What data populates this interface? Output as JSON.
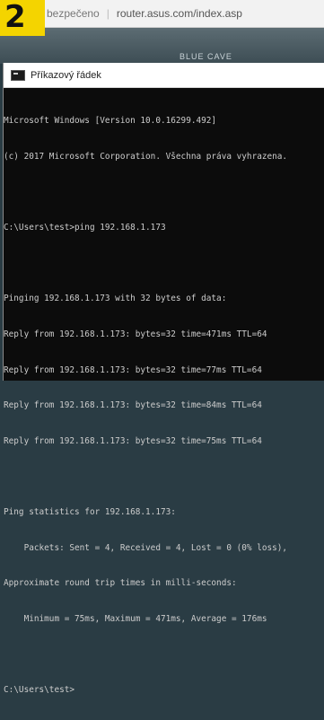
{
  "badge": "2",
  "browser": {
    "secure_label": "bezpečeno",
    "url": "router.asus.com/index.asp"
  },
  "router_banner": "BLUE CAVE",
  "cmd": {
    "title": "Příkazový řádek",
    "lines": [
      "Microsoft Windows [Version 10.0.16299.492]",
      "(c) 2017 Microsoft Corporation. Všechna práva vyhrazena.",
      "",
      "C:\\Users\\test>ping 192.168.1.173",
      "",
      "Pinging 192.168.1.173 with 32 bytes of data:",
      "Reply from 192.168.1.173: bytes=32 time=471ms TTL=64",
      "Reply from 192.168.1.173: bytes=32 time=77ms TTL=64",
      "Reply from 192.168.1.173: bytes=32 time=84ms TTL=64",
      "Reply from 192.168.1.173: bytes=32 time=75ms TTL=64",
      "",
      "Ping statistics for 192.168.1.173:",
      "    Packets: Sent = 4, Received = 4, Lost = 0 (0% loss),",
      "Approximate round trip times in milli-seconds:",
      "    Minimum = 75ms, Maximum = 471ms, Average = 176ms",
      "",
      "C:\\Users\\test>"
    ]
  }
}
